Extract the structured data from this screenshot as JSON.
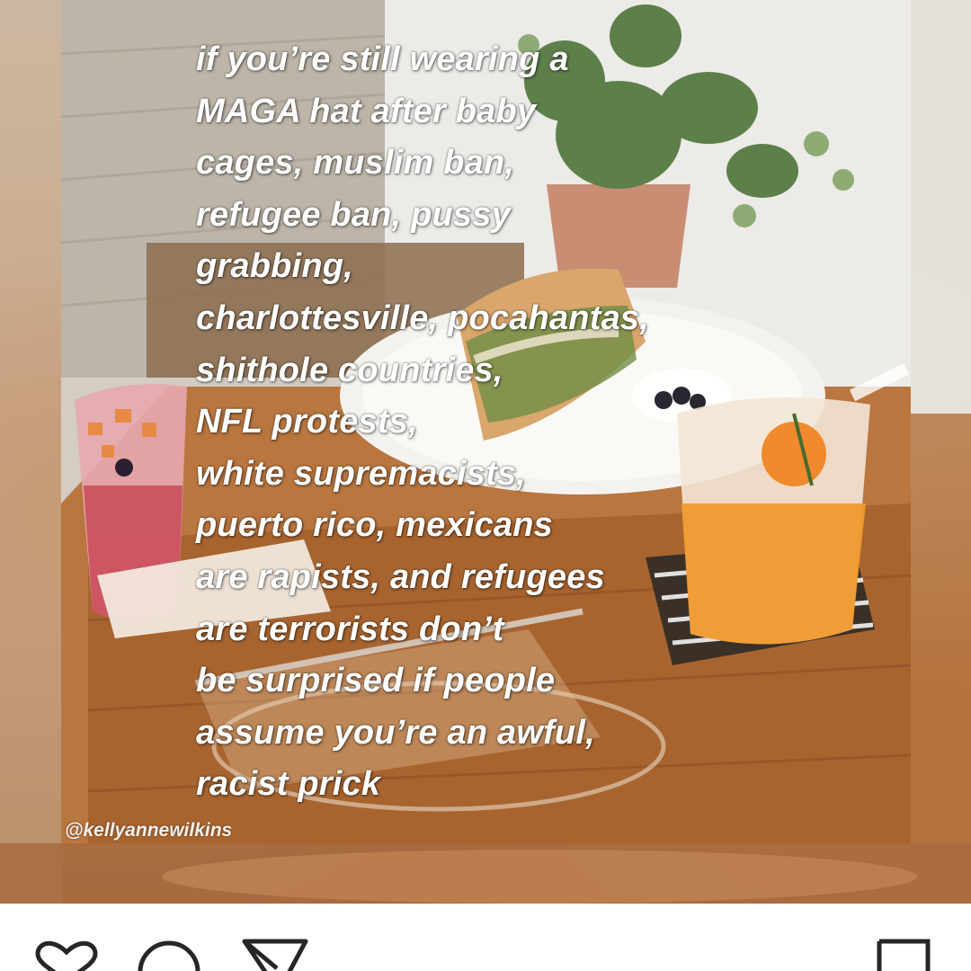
{
  "post": {
    "quote_lines": "if you’re still wearing a\nMAGA hat after baby\ncages, muslim ban,\nrefugee ban, pussy\ngrabbing,\ncharlottesville, pocahantas,\nshithole countries,\nNFL protests,\nwhite supremacists,\npuerto rico, mexicans\nare rapists, and refugees\nare terrorists don’t\nbe surprised if people\nassume you’re an awful,\nracist prick",
    "watermark": "@kellyannewilkins"
  },
  "actions": {
    "like_icon": "heart-icon",
    "comment_icon": "comment-icon",
    "share_icon": "send-icon",
    "save_icon": "bookmark-icon"
  },
  "colors": {
    "text": "#ffffff",
    "icon_stroke": "#262626",
    "bar_background": "#ffffff"
  }
}
